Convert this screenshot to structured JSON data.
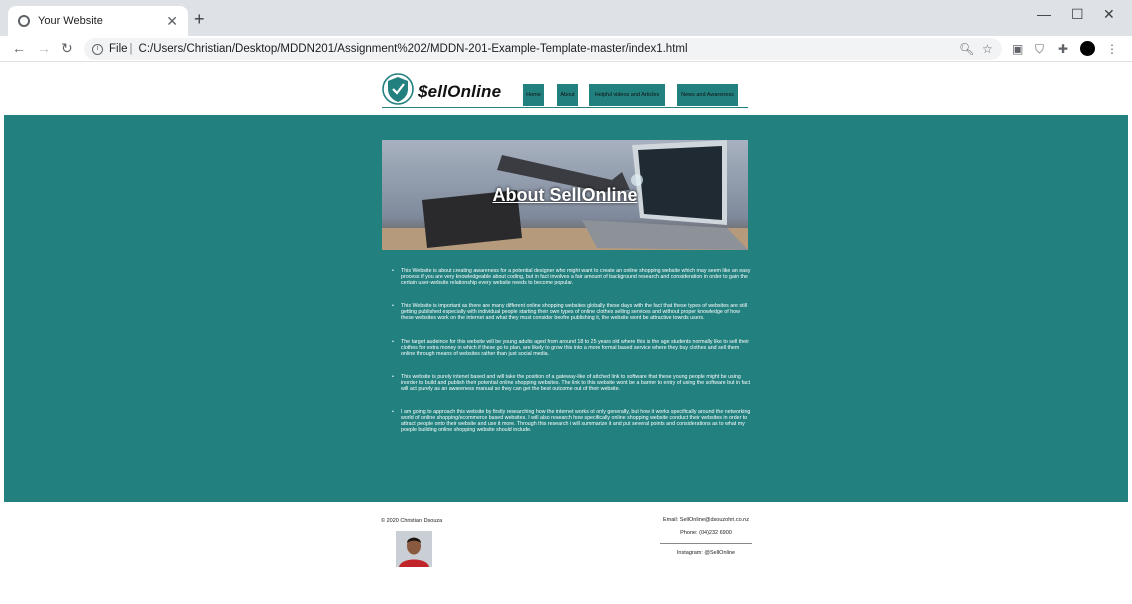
{
  "browser": {
    "tab_title": "Your Website",
    "new_tab_label": "+",
    "url_prefix": "File",
    "url": "C:/Users/Christian/Desktop/MDDN201/Assignment%202/MDDN-201-Example-Template-master/index1.html"
  },
  "site": {
    "logo_text": "$ellOnline",
    "nav": [
      "Home",
      "About",
      "Helpful videos and Articles",
      "News and Awareness"
    ]
  },
  "hero": {
    "title": "About SellOnline"
  },
  "points": [
    "This Website is about creating awareness for a potential designer who might want to create an online shopping website which may seem like an easy process if you are very knowledgeable about coding, but in fact involves a fair amount of background research and consideration in order to gain the certain user-website relationship every website needs to become popular.",
    "This Website is important as there are many different online shopping websites globally these days with the fact that these types of websites are still getting published especially with individual people starting their own types of online clothes selling services and without proper knowledge of how these websites work on the internet and what they must consider beofre publishing it, the website wont be attractive towrds users.",
    "The target audeince for this website will be young adults aged from around 18 to 25 years old where this is the age students normally like to sell their clothes for extra money in which if these go to plan, are likely to grow this into a more formal based service where they buy clothes and sell them online through means of websites rather than just social media.",
    "This website is purely intenet based and will take the position of a gateway-like of attched link to software that these young people might be using inorder to build and publish their potential online shopping websites. The link to this website wont be a barrier to entry of using the software but in fact will act purely as an awareness manual so they can get the best outcome out of their website.",
    "I am going to approach this website by firstly researching how the internet works ot only generally, but how it works specifically around the networking world of online shopping/ecommerce based websites. I will also research how specifically online shopping website conduct their websites in order to attract people onto their website and use it more. Through this research i will summarize it and put several points and considerations as to what my poeple building online shopping website should include."
  ],
  "footer": {
    "copyright": "© 2020 Christian Dsouza",
    "email": "Email: SellOnline@dsouzohri.co.nz",
    "phone": "Phone: (04)232 6900",
    "instagram": "Instagram: @SellOnline"
  },
  "colors": {
    "teal": "#22807f"
  }
}
